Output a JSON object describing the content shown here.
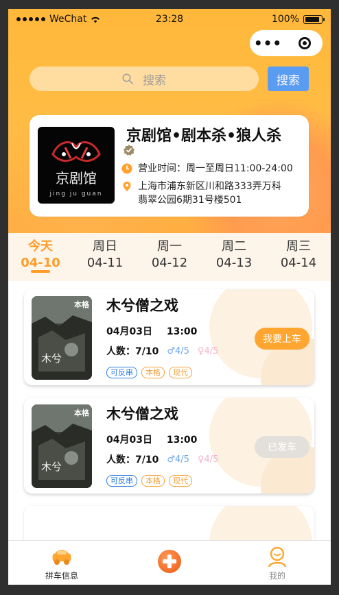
{
  "status_bar": {
    "carrier": "WeChat",
    "time": "23:28",
    "battery": "100%"
  },
  "search": {
    "placeholder": "搜索",
    "button_label": "搜索"
  },
  "shop": {
    "name": "京剧馆•剧本杀•狼人杀",
    "hours": "营业时间：周一至周日11:00-24:00",
    "address_line1": "上海市浦东新区川和路333弄万科",
    "address_line2": "翡翠公园6期31号楼501",
    "logo_text": "京剧馆",
    "logo_pinyin": "jing ju guan"
  },
  "days": [
    {
      "name": "今天",
      "date": "04-10",
      "active": true
    },
    {
      "name": "周日",
      "date": "04-11",
      "active": false
    },
    {
      "name": "周一",
      "date": "04-12",
      "active": false
    },
    {
      "name": "周二",
      "date": "04-13",
      "active": false
    },
    {
      "name": "周三",
      "date": "04-14",
      "active": false
    }
  ],
  "games": [
    {
      "title": "木兮僧之戏",
      "poster_tag": "本格",
      "date": "04月03日",
      "time": "13:00",
      "people": "人数：7/10",
      "male": "♂4/5",
      "female": "♀4/5",
      "tags": [
        "可反串",
        "本格",
        "现代"
      ],
      "action": "我要上车",
      "action_enabled": true
    },
    {
      "title": "木兮僧之戏",
      "poster_tag": "本格",
      "date": "04月03日",
      "time": "13:00",
      "people": "人数：7/10",
      "male": "♂4/5",
      "female": "♀4/5",
      "tags": [
        "可反串",
        "本格",
        "现代"
      ],
      "action": "已发车",
      "action_enabled": false
    }
  ],
  "tabbar": {
    "tab1": "拼车信息",
    "tab3": "我的"
  },
  "colors": {
    "accent": "#ff9d2a",
    "search_button": "#5b9cf3",
    "tag_blue": "#2d7de0",
    "tag_orange": "#f4a23a"
  }
}
